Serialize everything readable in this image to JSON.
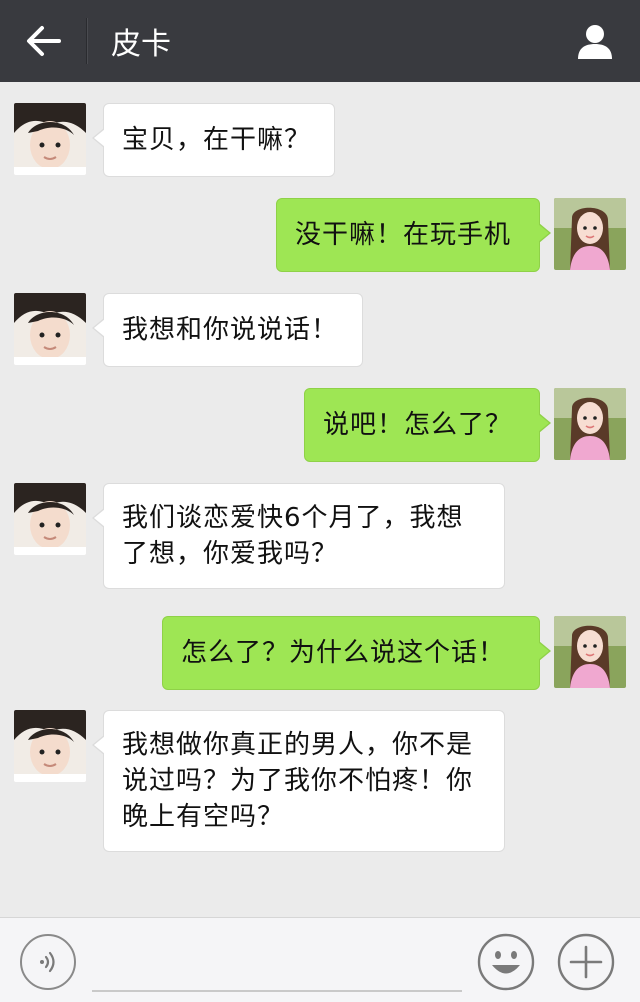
{
  "header": {
    "title": "皮卡",
    "back_icon": "back-arrow-icon",
    "profile_icon": "person-icon"
  },
  "messages": [
    {
      "side": "left",
      "text": "宝贝，在干嘛？"
    },
    {
      "side": "right",
      "text": "没干嘛！在玩手机"
    },
    {
      "side": "left",
      "text": "我想和你说说话！"
    },
    {
      "side": "right",
      "text": "说吧！怎么了？"
    },
    {
      "side": "left",
      "text": "我们谈恋爱快6个月了，我想了想，你爱我吗？"
    },
    {
      "side": "right",
      "text": "怎么了？为什么说这个话！"
    },
    {
      "side": "left",
      "text": "我想做你真正的男人，你不是说过吗？为了我你不怕疼！你晚上有空吗？"
    }
  ],
  "input": {
    "value": "",
    "placeholder": ""
  },
  "colors": {
    "header_bg": "#393a3f",
    "chat_bg": "#ebebeb",
    "sent_bubble": "#9ee654",
    "received_bubble": "#ffffff"
  }
}
